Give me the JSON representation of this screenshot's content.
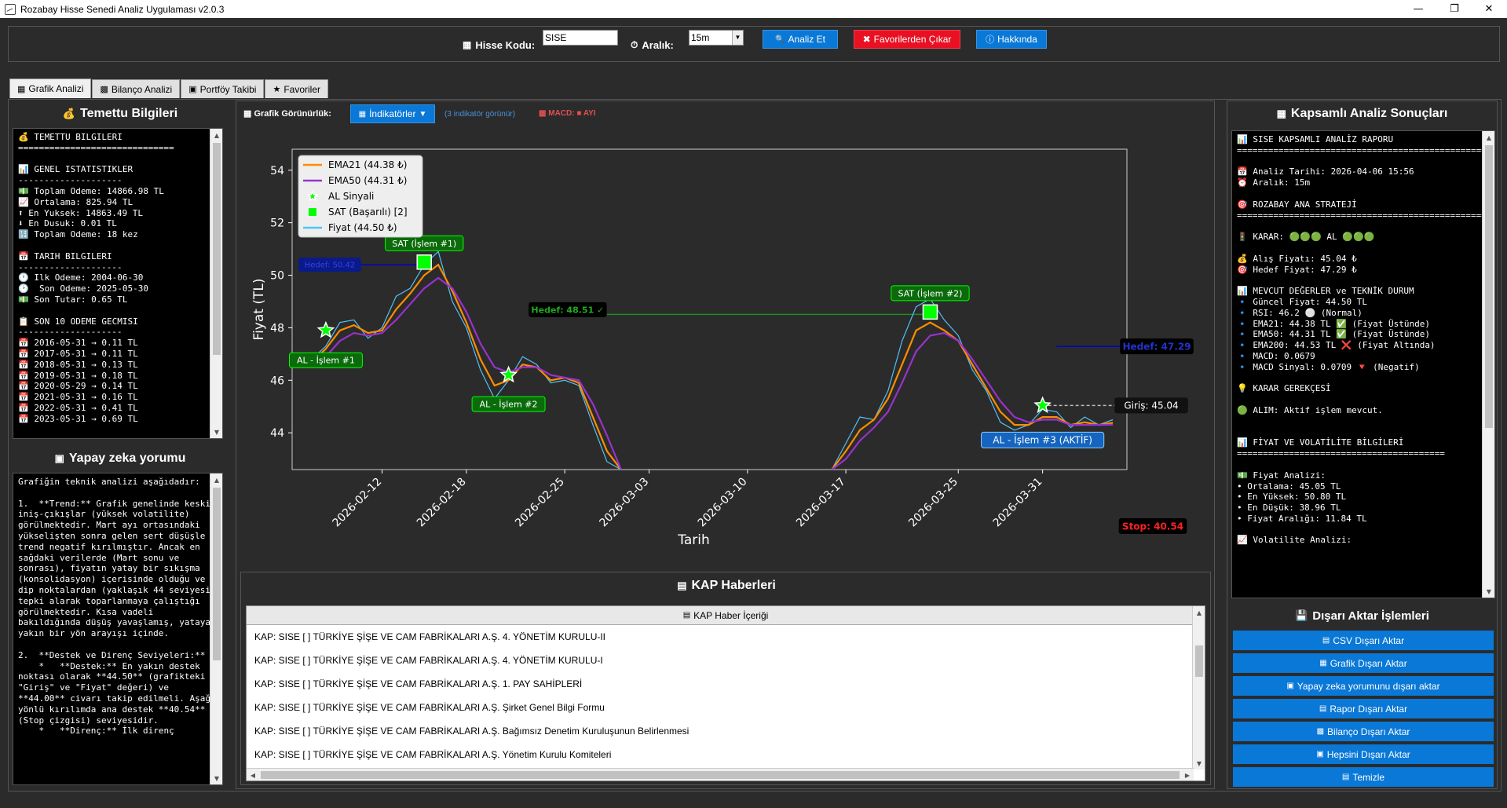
{
  "window": {
    "title": "Rozabay Hisse Senedi Analiz Uygulaması v2.0.3"
  },
  "toolbar": {
    "ticker_label": "Hisse Kodu:",
    "ticker_value": "SISE",
    "interval_label": "Aralık:",
    "interval_value": "15m",
    "analyze_btn": "Analiz Et",
    "fav_remove_btn": "Favorilerden Çıkar",
    "about_btn": "Hakkında"
  },
  "tabs": [
    {
      "label": "Grafik Analizi",
      "icon": "chart-icon"
    },
    {
      "label": "Bilanço Analizi",
      "icon": "calculator-icon"
    },
    {
      "label": "Portföy Takibi",
      "icon": "folder-icon"
    },
    {
      "label": "Favoriler",
      "icon": "star-icon"
    }
  ],
  "dividend": {
    "title": "Temettu Bilgileri",
    "text": "💰 TEMETTU BILGILERI\n==============================\n\n📊 GENEL ISTATISTIKLER\n--------------------\n💵 Toplam Odeme: 14866.98 TL\n📈 Ortalama: 825.94 TL\n⬆ En Yuksek: 14863.49 TL\n⬇ En Dusuk: 0.01 TL\n🔢 Toplam Odeme: 18 kez\n\n📅 TARIH BILGILERI\n--------------------\n🕐 Ilk Odeme: 2004-06-30\n🕑  Son Odeme: 2025-05-30\n💵 Son Tutar: 0.65 TL\n\n📋 SON 10 ODEME GECMISI\n--------------------\n📅 2016-05-31 → 0.11 TL\n📅 2017-05-31 → 0.11 TL\n📅 2018-05-31 → 0.13 TL\n📅 2019-05-31 → 0.18 TL\n📅 2020-05-29 → 0.14 TL\n📅 2021-05-31 → 0.16 TL\n📅 2022-05-31 → 0.41 TL\n📅 2023-05-31 → 0.69 TL"
  },
  "ai": {
    "title": "Yapay zeka yorumu",
    "text": "Grafiğin teknik analizi aşağıdadır:\n\n1.  **Trend:** Grafik genelinde keskin iniş-çıkışlar (yüksek volatilite) görülmektedir. Mart ayı ortasındaki yükselişten sonra gelen sert düşüşle trend negatif kırılmıştır. Ancak en sağdaki verilerde (Mart sonu ve sonrası), fiyatın yatay bir sıkışma (konsolidasyon) içerisinde olduğu ve dip noktalardan (yaklaşık 44 seviyesi) tepki alarak toparlanmaya çalıştığı görülmektedir. Kısa vadeli bakıldığında düşüş yavaşlamış, yataya yakın bir yön arayışı içinde.\n\n2.  **Destek ve Direnç Seviyeleri:**\n    *   **Destek:** En yakın destek noktası olarak **44.50** (grafikteki \"Giriş\" ve \"Fiyat\" değeri) ve **44.00** civarı takip edilmeli. Aşağı yönlü kırılımda ana destek **40.54** (Stop çizgisi) seviyesidir.\n    *   **Direnç:** İlk direnç"
  },
  "chart_header": {
    "visibility_label": "Grafik Görünürlük:",
    "indicators_btn": "İndikatörler",
    "indicators_count": "(3 indikatör görünür)",
    "macd_label": "MACD:",
    "macd_value": "AYI"
  },
  "chart_data": {
    "type": "line",
    "xlabel": "Tarih",
    "ylabel": "Fiyat (TL)",
    "ylim": [
      42.6,
      54.8
    ],
    "x_range": [
      "2026-02-07",
      "2026-04-05"
    ],
    "x_ticks": [
      "2026-02-12",
      "2026-02-18",
      "2026-02-25",
      "2026-03-03",
      "2026-03-10",
      "2026-03-17",
      "2026-03-25",
      "2026-03-31"
    ],
    "y_ticks": [
      44,
      46,
      48,
      50,
      52,
      54
    ],
    "legend": [
      {
        "label": "EMA21 (44.38 ₺)",
        "color": "#ff8c00",
        "kind": "line"
      },
      {
        "label": "EMA50 (44.31 ₺)",
        "color": "#9932cc",
        "kind": "line"
      },
      {
        "label": "AL Sinyali",
        "color": "#00ff00",
        "kind": "star"
      },
      {
        "label": "SAT (Başarılı) [2]",
        "color": "#00ff00",
        "kind": "square"
      },
      {
        "label": "Fiyat (44.50 ₺)",
        "color": "#4fc3f7",
        "kind": "line"
      }
    ],
    "series": [
      {
        "name": "Fiyat (44.50 ₺)",
        "color": "#4fc3f7",
        "points": [
          [
            "2026-02-07",
            46.8
          ],
          [
            "2026-02-08",
            47.3
          ],
          [
            "2026-02-09",
            48.2
          ],
          [
            "2026-02-10",
            48.3
          ],
          [
            "2026-02-11",
            47.6
          ],
          [
            "2026-02-12",
            48.0
          ],
          [
            "2026-02-13",
            49.2
          ],
          [
            "2026-02-14",
            49.5
          ],
          [
            "2026-02-15",
            50.4
          ],
          [
            "2026-02-16",
            50.9
          ],
          [
            "2026-02-17",
            49.0
          ],
          [
            "2026-02-18",
            48.0
          ],
          [
            "2026-02-19",
            46.4
          ],
          [
            "2026-02-20",
            45.3
          ],
          [
            "2026-02-21",
            46.0
          ],
          [
            "2026-02-22",
            46.9
          ],
          [
            "2026-02-23",
            46.6
          ],
          [
            "2026-02-24",
            45.9
          ],
          [
            "2026-02-25",
            46.0
          ],
          [
            "2026-02-26",
            45.8
          ],
          [
            "2026-02-27",
            44.3
          ],
          [
            "2026-02-28",
            42.9
          ],
          [
            "2026-03-01",
            42.6
          ]
        ]
      },
      {
        "name": "Fiyat (44.50 ₺)",
        "color": "#4fc3f7",
        "points": [
          [
            "2026-03-16",
            42.6
          ],
          [
            "2026-03-17",
            43.6
          ],
          [
            "2026-03-18",
            44.6
          ],
          [
            "2026-03-19",
            44.5
          ],
          [
            "2026-03-20",
            45.6
          ],
          [
            "2026-03-21",
            47.5
          ],
          [
            "2026-03-22",
            48.8
          ],
          [
            "2026-03-23",
            49.1
          ],
          [
            "2026-03-24",
            48.3
          ],
          [
            "2026-03-25",
            47.7
          ],
          [
            "2026-03-26",
            46.4
          ],
          [
            "2026-03-27",
            45.6
          ],
          [
            "2026-03-28",
            44.4
          ],
          [
            "2026-03-29",
            44.1
          ],
          [
            "2026-03-30",
            44.3
          ],
          [
            "2026-03-31",
            44.9
          ],
          [
            "2026-04-01",
            44.8
          ],
          [
            "2026-04-02",
            44.2
          ],
          [
            "2026-04-03",
            44.6
          ],
          [
            "2026-04-04",
            44.3
          ],
          [
            "2026-04-05",
            44.5
          ]
        ]
      },
      {
        "name": "EMA21 (44.38 ₺)",
        "color": "#ff8c00",
        "points": [
          [
            "2026-02-07",
            46.7
          ],
          [
            "2026-02-08",
            47.2
          ],
          [
            "2026-02-09",
            47.9
          ],
          [
            "2026-02-10",
            48.1
          ],
          [
            "2026-02-11",
            47.8
          ],
          [
            "2026-02-12",
            47.9
          ],
          [
            "2026-02-13",
            48.7
          ],
          [
            "2026-02-14",
            49.3
          ],
          [
            "2026-02-15",
            50.0
          ],
          [
            "2026-02-16",
            50.4
          ],
          [
            "2026-02-17",
            49.4
          ],
          [
            "2026-02-18",
            48.2
          ],
          [
            "2026-02-19",
            46.8
          ],
          [
            "2026-02-20",
            45.8
          ],
          [
            "2026-02-21",
            46.0
          ],
          [
            "2026-02-22",
            46.6
          ],
          [
            "2026-02-23",
            46.5
          ],
          [
            "2026-02-24",
            46.0
          ],
          [
            "2026-02-25",
            46.1
          ],
          [
            "2026-02-26",
            45.9
          ],
          [
            "2026-02-27",
            44.6
          ],
          [
            "2026-02-28",
            43.3
          ],
          [
            "2026-03-01",
            42.6
          ]
        ]
      },
      {
        "name": "EMA21 (44.38 ₺)",
        "color": "#ff8c00",
        "points": [
          [
            "2026-03-16",
            42.6
          ],
          [
            "2026-03-17",
            43.3
          ],
          [
            "2026-03-18",
            44.1
          ],
          [
            "2026-03-19",
            44.5
          ],
          [
            "2026-03-20",
            45.3
          ],
          [
            "2026-03-21",
            46.6
          ],
          [
            "2026-03-22",
            47.9
          ],
          [
            "2026-03-23",
            48.2
          ],
          [
            "2026-03-24",
            47.9
          ],
          [
            "2026-03-25",
            47.5
          ],
          [
            "2026-03-26",
            46.6
          ],
          [
            "2026-03-27",
            45.7
          ],
          [
            "2026-03-28",
            44.8
          ],
          [
            "2026-03-29",
            44.3
          ],
          [
            "2026-03-30",
            44.3
          ],
          [
            "2026-03-31",
            44.6
          ],
          [
            "2026-04-01",
            44.6
          ],
          [
            "2026-04-02",
            44.3
          ],
          [
            "2026-04-03",
            44.4
          ],
          [
            "2026-04-04",
            44.3
          ],
          [
            "2026-04-05",
            44.38
          ]
        ]
      },
      {
        "name": "EMA50 (44.31 ₺)",
        "color": "#9932cc",
        "points": [
          [
            "2026-02-07",
            46.5
          ],
          [
            "2026-02-08",
            46.9
          ],
          [
            "2026-02-09",
            47.5
          ],
          [
            "2026-02-10",
            47.8
          ],
          [
            "2026-02-11",
            47.7
          ],
          [
            "2026-02-12",
            47.8
          ],
          [
            "2026-02-13",
            48.3
          ],
          [
            "2026-02-14",
            48.9
          ],
          [
            "2026-02-15",
            49.5
          ],
          [
            "2026-02-16",
            49.9
          ],
          [
            "2026-02-17",
            49.5
          ],
          [
            "2026-02-18",
            48.6
          ],
          [
            "2026-02-19",
            47.4
          ],
          [
            "2026-02-20",
            46.5
          ],
          [
            "2026-02-21",
            46.3
          ],
          [
            "2026-02-22",
            46.5
          ],
          [
            "2026-02-23",
            46.5
          ],
          [
            "2026-02-24",
            46.2
          ],
          [
            "2026-02-25",
            46.1
          ],
          [
            "2026-02-26",
            46.0
          ],
          [
            "2026-02-27",
            45.1
          ],
          [
            "2026-02-28",
            43.9
          ],
          [
            "2026-03-01",
            42.6
          ]
        ]
      },
      {
        "name": "EMA50 (44.31 ₺)",
        "color": "#9932cc",
        "points": [
          [
            "2026-03-16",
            42.6
          ],
          [
            "2026-03-17",
            43.0
          ],
          [
            "2026-03-18",
            43.7
          ],
          [
            "2026-03-19",
            44.2
          ],
          [
            "2026-03-20",
            44.8
          ],
          [
            "2026-03-21",
            45.9
          ],
          [
            "2026-03-22",
            47.1
          ],
          [
            "2026-03-23",
            47.7
          ],
          [
            "2026-03-24",
            47.8
          ],
          [
            "2026-03-25",
            47.5
          ],
          [
            "2026-03-26",
            46.8
          ],
          [
            "2026-03-27",
            46.0
          ],
          [
            "2026-03-28",
            45.2
          ],
          [
            "2026-03-29",
            44.6
          ],
          [
            "2026-03-30",
            44.4
          ],
          [
            "2026-03-31",
            44.5
          ],
          [
            "2026-04-01",
            44.5
          ],
          [
            "2026-04-02",
            44.3
          ],
          [
            "2026-04-03",
            44.3
          ],
          [
            "2026-04-04",
            44.3
          ],
          [
            "2026-04-05",
            44.31
          ]
        ]
      }
    ],
    "buy_signals": [
      {
        "x": "2026-02-08",
        "y": 47.9,
        "label": "AL - İşlem #1"
      },
      {
        "x": "2026-02-21",
        "y": 46.2,
        "label": "AL - İşlem #2"
      },
      {
        "x": "2026-03-31",
        "y": 45.04,
        "label": "AL - İşlem #3 (AKTİF)"
      }
    ],
    "sell_signals": [
      {
        "x": "2026-02-15",
        "y": 50.5,
        "label": "SAT (İşlem #1)"
      },
      {
        "x": "2026-03-23",
        "y": 48.6,
        "label": "SAT (İşlem #2)"
      }
    ],
    "hlines": [
      {
        "y": 50.4,
        "x_from": "2026-02-08",
        "x_to": "2026-02-15",
        "color": "#0000cd",
        "label": "Hedef: 50.42"
      },
      {
        "y": 48.51,
        "x_from": "2026-02-28",
        "x_to": "2026-03-23",
        "color": "#228b22",
        "label": "Hedef: 48.51 ✓"
      },
      {
        "y": 47.29,
        "x_from": "2026-04-01",
        "x_to": "2026-04-06",
        "color": "#0000cd",
        "label": "Hedef: 47.29"
      },
      {
        "y": 45.04,
        "x_from": "2026-03-31",
        "x_to": "2026-04-06",
        "color": "#bbbbbb",
        "label": "Giriş: 45.04"
      }
    ],
    "stop_label": "Stop: 40.54"
  },
  "kap": {
    "title": "KAP Haberleri",
    "header": "KAP Haber İçeriği",
    "items": [
      "KAP: SISE  [ ] TÜRKİYE ŞİŞE VE CAM FABRİKALARI A.Ş.  4. YÖNETİM KURULU-II",
      "KAP: SISE  [ ] TÜRKİYE ŞİŞE VE CAM FABRİKALARI A.Ş.  4. YÖNETİM KURULU-I",
      "KAP: SISE  [ ] TÜRKİYE ŞİŞE VE CAM FABRİKALARI A.Ş.  1. PAY SAHİPLERİ",
      "KAP: SISE  [ ] TÜRKİYE ŞİŞE VE CAM FABRİKALARI A.Ş.  Şirket Genel Bilgi Formu",
      "KAP: SISE  [ ] TÜRKİYE ŞİŞE VE CAM FABRİKALARI A.Ş.  Bağımsız Denetim Kuruluşunun Belirlenmesi",
      "KAP: SISE  [ ] TÜRKİYE ŞİŞE VE CAM FABRİKALARI A.Ş.  Yönetim Kurulu Komiteleri"
    ]
  },
  "report": {
    "title": "Kapsamlı Analiz Sonuçları",
    "text": "📊 SISE KAPSAMLI ANALİZ RAPORU\n==================================================\n\n📅 Analiz Tarihi: 2026-04-06 15:56\n⏰ Aralık: 15m\n\n🎯 ROZABAY ANA STRATEJİ\n==================================================\n\n🚦 KARAR: 🟢🟢🟢 AL 🟢🟢🟢\n\n💰 Alış Fiyatı: 45.04 ₺\n🎯 Hedef Fiyat: 47.29 ₺\n\n📊 MEVCUT DEĞERLER ve TEKNİK DURUM\n🔹 Güncel Fiyat: 44.50 TL\n🔹 RSI: 46.2 ⚪ (Normal)\n🔹 EMA21: 44.38 TL ✅ (Fiyat Üstünde)\n🔹 EMA50: 44.31 TL ✅ (Fiyat Üstünde)\n🔹 EMA200: 44.53 TL ❌ (Fiyat Altında)\n🔹 MACD: 0.0679\n🔹 MACD Sinyal: 0.0709 🔻 (Negatif)\n\n💡 KARAR GEREKÇESİ\n\n🟢 ALIM: Aktif işlem mevcut.\n\n\n📊 FİYAT VE VOLATİLİTE BİLGİLERİ\n========================================\n\n💵 Fiyat Analizi:\n• Ortalama: 45.05 TL\n• En Yüksek: 50.80 TL\n• En Düşük: 38.96 TL\n• Fiyat Aralığı: 11.84 TL\n\n📈 Volatilite Analizi:"
  },
  "export": {
    "title": "Dışarı Aktar İşlemleri",
    "buttons": [
      "CSV Dışarı Aktar",
      "Grafik Dışarı Aktar",
      "Yapay zeka yorumunu dışarı aktar",
      "Rapor Dışarı Aktar",
      "Bilanço Dışarı Aktar",
      "Hepsini Dışarı Aktar",
      "Temizle"
    ]
  },
  "colors": {
    "accent_blue": "#0a78d7",
    "danger_red": "#e81123",
    "panel_bg": "#2b2b2b",
    "text_box_bg": "#000000"
  }
}
